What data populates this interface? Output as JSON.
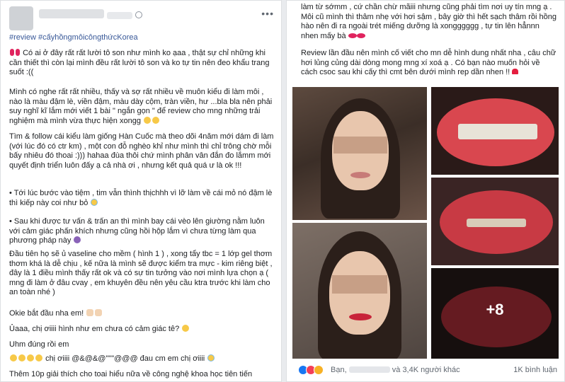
{
  "left_post": {
    "hashtags": "#review #cấyhồngmôicôngthứcKorea",
    "paragraphs": [
      "Có ai ở đây rất rất lười tô son như mình ko ạaa , thật sự chỉ những khi cần thiết thì còn lại mình đều rất lười tô son và ko tự tin nên đeo khẩu trang suốt :((",
      "Mình có nghe rất rất nhiều, thấy và sợ rất nhiều về muôn kiểu đi làm môi , nào là màu đậm lè, viền đậm, màu dày cộm, tràn viền, hư ...bla bla nên phải suy nghĩ kĩ lắm mới viết 1 bài \" ngắn gọn \" để review cho mng những trải nghiệm mà mình vừa thực hiện xongg",
      "Tìm & follow cái kiểu làm giống Hàn Cuốc mà theo dõi 4năm mới dám đi làm (với lúc đó có ctr km) , một con đỗ nghèo khỉ như mình thì chỉ trông chờ mỗi bấy nhiêu đó thoai :))) hahaa đùa thôi chứ mình phân vân đắn đo lắmm mới quyết định triển luôn đấy ạ cả nhà ơi , nhưng kết quả quá ư là ok !!!",
      "• Tới lúc bước vào tiệm , tim vẫn thình thịchhh vì lỡ làm về cái mỏ nó đậm lè thì kiếp này coi như bỏ",
      "• Sau khi được tư vấn & trấn an thì mình bay cái vèo lên giường nằm luôn với cảm giác phấn khích nhưng cũng hồi hộp lắm vì chưa từng làm qua phương pháp này",
      "Đầu tiên họ sẽ ủ vaseline cho mềm ( hình 1 ) , xong tẩy tbc = 1 lớp gel thơm thơm khá là dễ chịu , kế nữa là mình sẽ được kiểm tra mực - kim riêng biệt , đây là 1 điều mình thấy rất ok và có sự tin tưởng vào nơi mình lựa chọn ạ ( mng đi làm ở đâu cvay , em khuyên đều nên yêu cầu ktra trước khi làm cho an toàn nhé )",
      "Okie bắt đầu nha em!",
      "Ủaaa, chị ơiiii hình như em chưa có cảm giác tê?",
      "Uhm đúng rồi em",
      "chị ơiiii @&@&@\"\"\"@@@ đau cm em chị ơiiii",
      "Thêm 10p giải thích cho toai hiểu nữa về công nghệ khoa học tiên tiến"
    ]
  },
  "right_post": {
    "top_text": "làm từ sớmm , cứ chần chừ mãiii nhưng cũng phải tìm nơi uy tín mng ạ . Môi cũ mình thì thâm nhẹ với hơi sậm , bây giờ thì hết sạch thâm rồi hồng hào nên đi ra ngoài trét miếng dưỡng là xongggggg , tự tin lên hẳnnn nhen mấy bà",
    "second_text": "Review lần đầu nên mình cố viết cho mn dễ hình dung nhất nha , câu chữ hơi lủng củng dài dòng mong mng xí xoá ạ . Có bạn nào muốn hỏi về cách csoc sau khi cấy thì cmt bên dưới mình rep dần nhen !!",
    "more_photos": "+8",
    "reactions": {
      "text_prefix": "Bạn,",
      "text_suffix": "và 3,4K người khác",
      "views": "1K bình luận"
    }
  }
}
